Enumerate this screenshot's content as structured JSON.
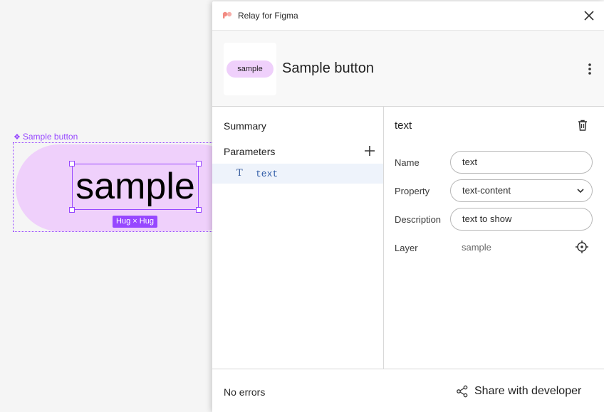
{
  "canvas": {
    "frame_label": "Sample button",
    "component_text": "sample",
    "hug_badge": "Hug × Hug",
    "accent_color": "#9747ff",
    "fill_color": "#efd0fb"
  },
  "panel": {
    "title": "Relay for Figma",
    "component": {
      "thumbnail_text": "sample",
      "name": "Sample button"
    },
    "nav": {
      "summary": "Summary",
      "parameters": "Parameters",
      "parameter_items": [
        {
          "icon": "text-type-icon",
          "label": "text"
        }
      ]
    },
    "detail": {
      "title": "text",
      "name_label": "Name",
      "name_value": "text",
      "property_label": "Property",
      "property_value": "text-content",
      "description_label": "Description",
      "description_value": "text to show",
      "layer_label": "Layer",
      "layer_value": "sample"
    },
    "footer": {
      "status": "No errors",
      "share_label": "Share with developer"
    }
  }
}
